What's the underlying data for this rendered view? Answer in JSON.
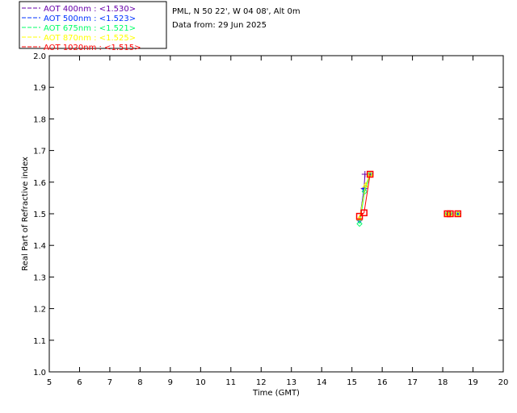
{
  "header": {
    "site": "PML, N 50 22', W 04 08', Alt 0m",
    "date": "Data from: 29 Jun 2025"
  },
  "chart_data": {
    "type": "scatter",
    "xlabel": "Time (GMT)",
    "ylabel": "Real Part of Refractive index",
    "xlim": [
      5,
      20
    ],
    "ylim": [
      1.0,
      2.0
    ],
    "xticks": [
      "5",
      "6",
      "7",
      "8",
      "9",
      "10",
      "11",
      "12",
      "13",
      "14",
      "15",
      "16",
      "17",
      "18",
      "19",
      "20"
    ],
    "yticks": [
      "1.0",
      "1.1",
      "1.2",
      "1.3",
      "1.4",
      "1.5",
      "1.6",
      "1.7",
      "1.8",
      "1.9",
      "2.0"
    ],
    "series": [
      {
        "name": "AOT  400nm : <1.530>",
        "color": "#6600aa",
        "marker": "plus",
        "x": [
          15.25,
          15.4,
          15.43,
          18.15,
          18.25,
          18.5
        ],
        "y": [
          1.48,
          1.58,
          1.625,
          1.5,
          1.5,
          1.5
        ]
      },
      {
        "name": "AOT  500nm : <1.523>",
        "color": "#0033ff",
        "marker": "star",
        "x": [
          15.25,
          15.4,
          15.6,
          18.15,
          18.25,
          18.5
        ],
        "y": [
          1.478,
          1.578,
          1.625,
          1.5,
          1.5,
          1.5
        ]
      },
      {
        "name": "AOT  675nm : <1.521>",
        "color": "#00ff66",
        "marker": "diamond",
        "x": [
          15.25,
          15.42,
          15.6,
          18.15,
          18.25,
          18.5
        ],
        "y": [
          1.468,
          1.57,
          1.625,
          1.5,
          1.5,
          1.5
        ]
      },
      {
        "name": "AOT  870nm : <1.525>",
        "color": "#ffff00",
        "marker": "triangle",
        "x": [
          15.25,
          15.45,
          15.6,
          18.15,
          18.25,
          18.5
        ],
        "y": [
          1.485,
          1.59,
          1.625,
          1.5,
          1.5,
          1.5
        ]
      },
      {
        "name": "AOT 1020nm : <1.515>",
        "color": "#ff0000",
        "marker": "square",
        "x": [
          15.25,
          15.4,
          15.6,
          18.15,
          18.25,
          18.5
        ],
        "y": [
          1.492,
          1.503,
          1.625,
          1.5,
          1.5,
          1.5
        ]
      }
    ],
    "legend": "top-left outside",
    "grid": false
  }
}
